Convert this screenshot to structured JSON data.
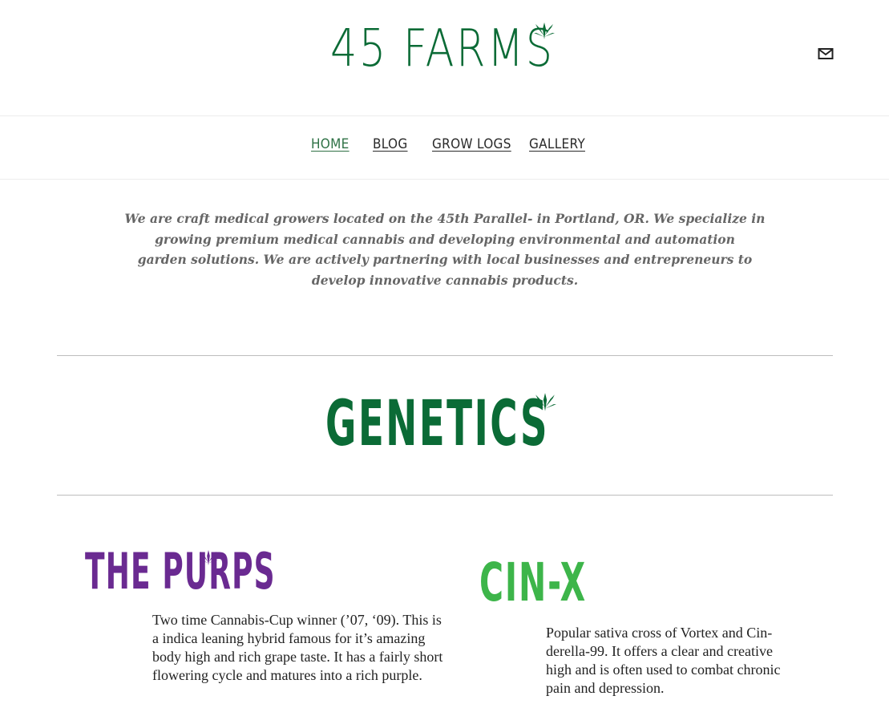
{
  "header": {
    "logo_text": "45 FARMS",
    "contact_icon": "mail-icon"
  },
  "nav": {
    "items": [
      {
        "label": "HOME",
        "active": true
      },
      {
        "label": "BLOG",
        "active": false
      },
      {
        "label": "GROW LOGS",
        "active": false
      },
      {
        "label": "GALLERY",
        "active": false
      }
    ]
  },
  "intro": {
    "line1": "We are craft medical growers located on the 45th Parallel- in Portland, OR.  We specialize in",
    "line2": "growing premium medical cannabis and developing environmental and automation",
    "line3": "garden solutions.  We are actively partnering with local businesses and entrepreneurs to",
    "line4": "develop innovative cannabis products."
  },
  "genetics": {
    "heading": "GENETICS"
  },
  "strains": [
    {
      "name": "THE PURPS",
      "color": "#6a2a91",
      "desc_lines": [
        "Two time Cannabis-Cup winner (’07, ‘09). This is",
        "a indica leaning hybrid famous for it’s amazing",
        "body high and rich grape taste. It has a fairly short",
        "flowering cycle and matures into a rich purple."
      ]
    },
    {
      "name": "CIN-X",
      "color": "#3db54a",
      "desc_lines": [
        "Popular sativa cross of Vortex and Cin-",
        "derella-99. It offers a clear and creative",
        "high and is often used to combat chronic",
        "pain and depression."
      ]
    }
  ],
  "colors": {
    "brand_green": "#0b6b36",
    "nav_active": "#2e7145",
    "intro_text": "#666666"
  }
}
